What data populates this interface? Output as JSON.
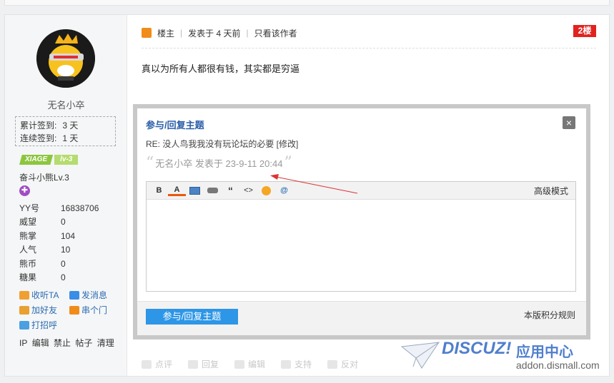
{
  "user": {
    "username": "无名小卒",
    "sign_total_label": "累计签到:",
    "sign_total": "3 天",
    "sign_streak_label": "连续签到:",
    "sign_streak": "1 天",
    "level_brand": "XIAGE",
    "level_tag": "lv-3",
    "rank_name": "奋斗小熊Lv.3",
    "stats": [
      {
        "key": "YY号",
        "value": "16838706"
      },
      {
        "key": "威望",
        "value": "0"
      },
      {
        "key": "熊掌",
        "value": "104"
      },
      {
        "key": "人气",
        "value": "10"
      },
      {
        "key": "熊币",
        "value": "0"
      },
      {
        "key": "糖果",
        "value": "0"
      }
    ],
    "links": [
      "收听TA",
      "发消息",
      "加好友",
      "串个门",
      "打招呼"
    ],
    "admin_links": [
      "IP",
      "编辑",
      "禁止",
      "帖子",
      "清理"
    ]
  },
  "post": {
    "author_role": "楼主",
    "posted": "发表于 4 天前",
    "only_author": "只看该作者",
    "floor": "2楼",
    "content": "真以为所有人都很有钱，其实都是穷逼"
  },
  "dialog": {
    "title": "参与/回复主题",
    "close": "×",
    "subject": "RE: 没人鸟我我没有玩论坛的必要 [修改]",
    "quote_open": "“",
    "quote": "无名小卒 发表于 23-9-11 20:44",
    "quote_close": "”",
    "toolbar": [
      "B",
      "A",
      "img",
      "link",
      "“",
      "<>",
      "emoji",
      "@"
    ],
    "advanced": "高级模式",
    "submit": "参与/回复主题",
    "rules": "本版积分规则"
  },
  "actions": [
    "点评",
    "回复",
    "编辑",
    "支持",
    "反对"
  ],
  "watermark": {
    "brand": "DISCUZ!",
    "center": "应用中心",
    "domain": "addon.dismall.com"
  },
  "colors": {
    "link": "#2b6cb2",
    "dialog_title": "#2b5ea8",
    "floor_badge": "#e12320",
    "submit": "#2d96e6",
    "level": "#8cc63f"
  }
}
